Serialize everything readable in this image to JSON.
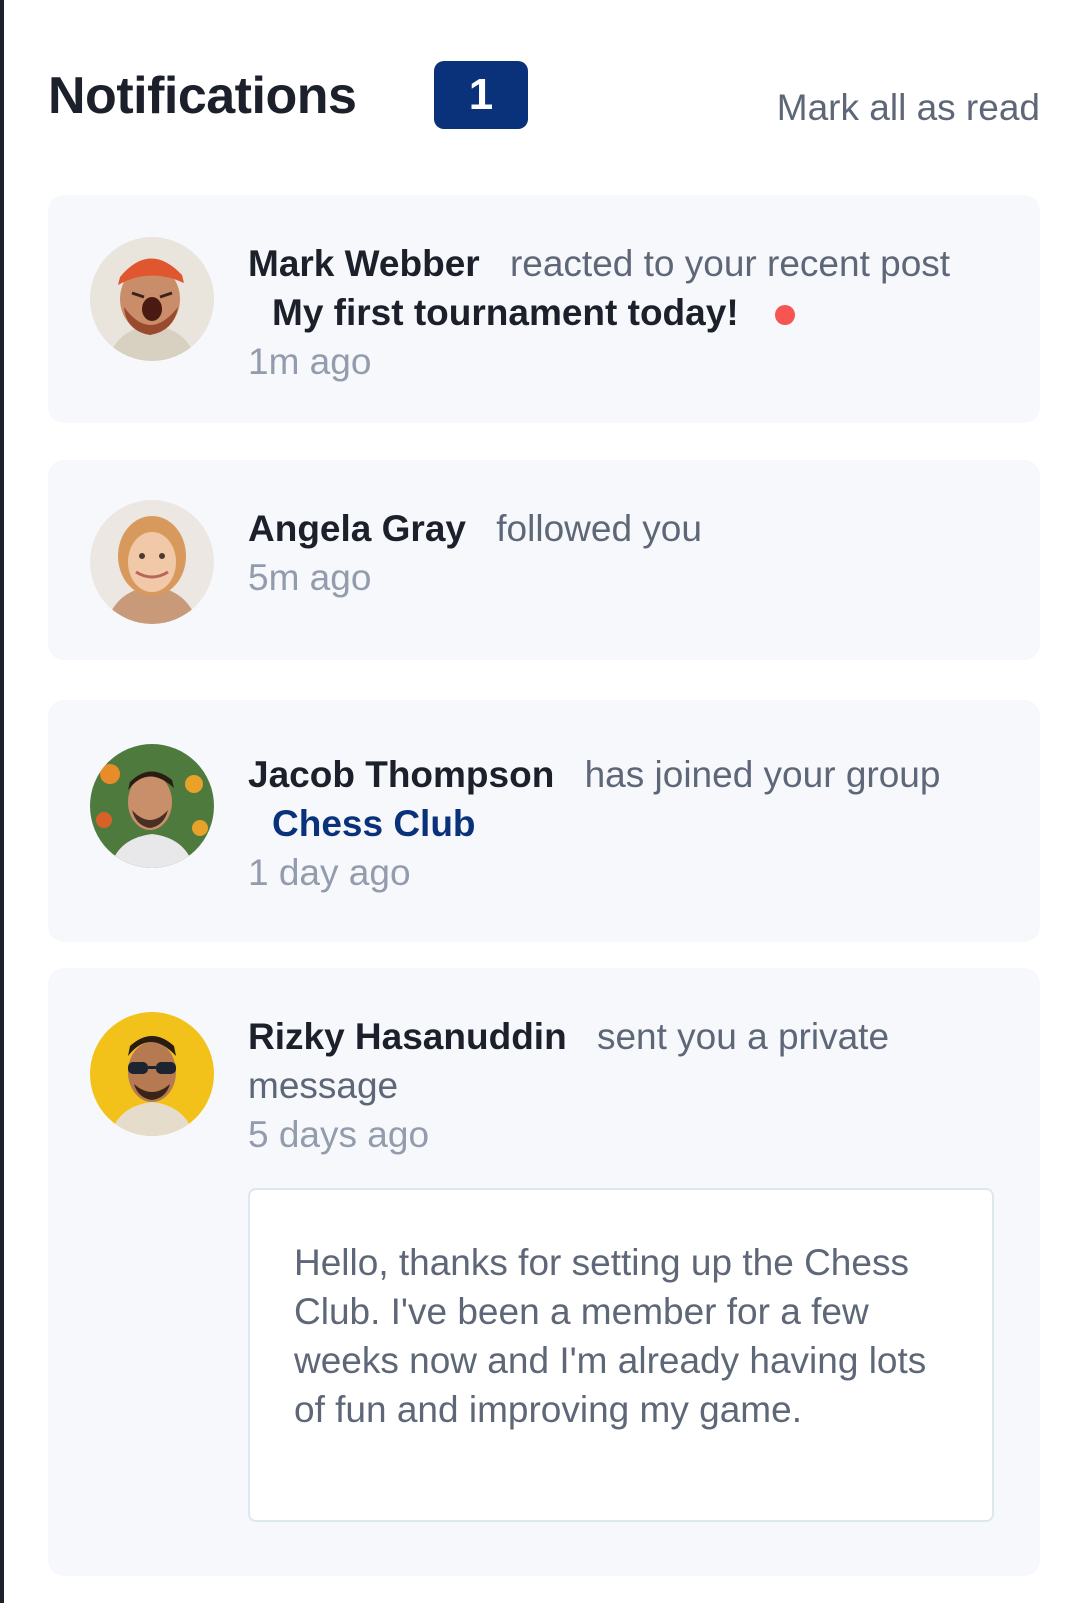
{
  "header": {
    "title": "Notifications",
    "count": "1",
    "mark_all_label": "Mark all as read"
  },
  "notifications": [
    {
      "name": "Mark Webber",
      "action": "reacted to your recent post",
      "target": "My first tournament today!",
      "time": "1m ago",
      "unread": true,
      "avatar": "avatar-mark-webber"
    },
    {
      "name": "Angela Gray",
      "action": "followed you",
      "time": "5m ago",
      "avatar": "avatar-angela-gray"
    },
    {
      "name": "Jacob Thompson",
      "action": "has joined your group",
      "group": "Chess Club",
      "time": "1 day ago",
      "avatar": "avatar-jacob-thompson"
    },
    {
      "name": "Rizky Hasanuddin",
      "action": "sent you a private message",
      "time": "5 days ago",
      "message": "Hello, thanks for setting up the Chess Club. I've been a member for a few weeks now and I'm already having lots of fun and improving my game.",
      "avatar": "avatar-rizky-hasanuddin"
    }
  ],
  "colors": {
    "brand_badge": "#0a327b",
    "unread_dot": "#f65552",
    "card_bg": "#f6f8fb",
    "text_dark": "#1c202b",
    "text_gray": "#5e6778",
    "text_light": "#939cad"
  }
}
